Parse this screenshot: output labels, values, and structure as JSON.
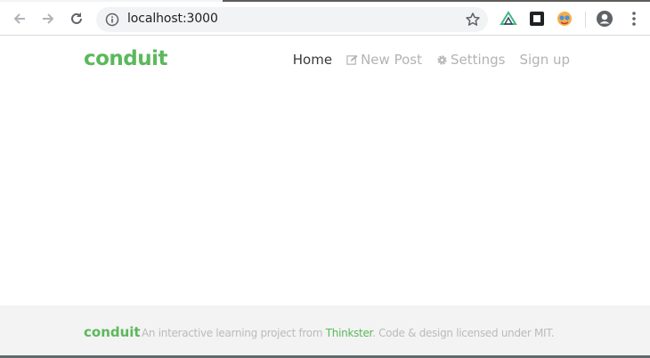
{
  "browser": {
    "url": "localhost:3000"
  },
  "site": {
    "brand": "conduit",
    "nav": [
      {
        "label": "Home",
        "icon": "",
        "active": true
      },
      {
        "label": "New Post",
        "icon": "edit-icon",
        "active": false
      },
      {
        "label": "Settings",
        "icon": "gear-icon",
        "active": false
      },
      {
        "label": "Sign up",
        "icon": "",
        "active": false
      }
    ],
    "accent_color": "#5cb85c"
  },
  "footer": {
    "brand": "conduit",
    "text_before": "An interactive learning project from ",
    "link": "Thinkster",
    "text_after": ". Code & design licensed under MIT."
  }
}
